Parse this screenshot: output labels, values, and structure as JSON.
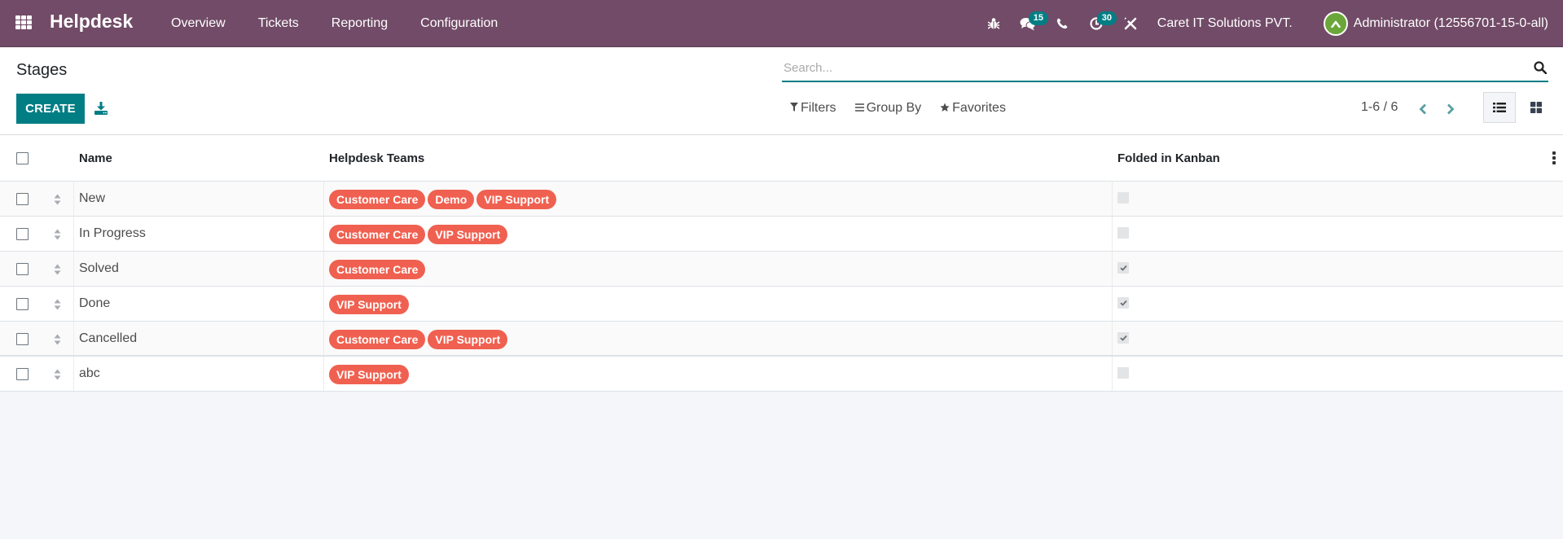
{
  "navbar": {
    "app_name": "Helpdesk",
    "menu": [
      {
        "label": "Overview"
      },
      {
        "label": "Tickets"
      },
      {
        "label": "Reporting"
      },
      {
        "label": "Configuration"
      }
    ],
    "systray": {
      "bug_icon": "bug-icon",
      "messages_count": "15",
      "phone_icon": "phone-icon",
      "activities_count": "30",
      "tools_icon": "tools-icon"
    },
    "company": "Caret IT Solutions PVT.",
    "user": "Administrator (12556701-15-0-all)",
    "avatar_color": "#6ba63b",
    "bg_color": "#714b67"
  },
  "control_panel": {
    "title": "Stages",
    "create_label": "CREATE",
    "search": {
      "placeholder": "Search...",
      "value": ""
    },
    "filters_label": "Filters",
    "groupby_label": "Group By",
    "favorites_label": "Favorites",
    "pager": "1-6 / 6",
    "active_view": "list"
  },
  "table": {
    "columns": [
      "Name",
      "Helpdesk Teams",
      "Folded in Kanban"
    ],
    "rows": [
      {
        "name": "New",
        "teams": [
          "Customer Care",
          "Demo",
          "VIP Support"
        ],
        "folded": false
      },
      {
        "name": "In Progress",
        "teams": [
          "Customer Care",
          "VIP Support"
        ],
        "folded": false
      },
      {
        "name": "Solved",
        "teams": [
          "Customer Care"
        ],
        "folded": true
      },
      {
        "name": "Done",
        "teams": [
          "VIP Support"
        ],
        "folded": true
      },
      {
        "name": "Cancelled",
        "teams": [
          "Customer Care",
          "VIP Support"
        ],
        "folded": true
      },
      {
        "name": "abc",
        "teams": [
          "VIP Support"
        ],
        "folded": false
      }
    ]
  },
  "colors": {
    "primary": "#017e84",
    "tag": "#f06050"
  }
}
